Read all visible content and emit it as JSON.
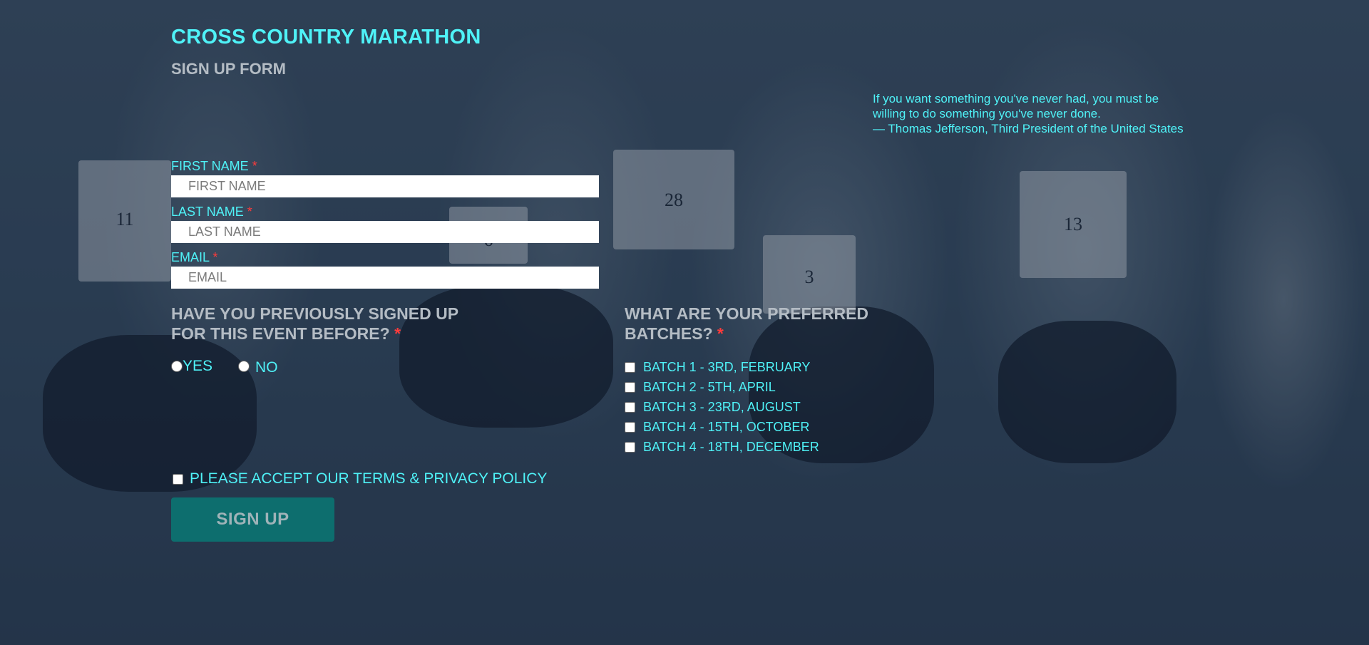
{
  "header": {
    "title": "CROSS COUNTRY MARATHON",
    "subtitle": "SIGN UP FORM"
  },
  "quote": {
    "text": "If you want something you've never had, you must be willing to do something you've never done.",
    "attribution": "— Thomas Jefferson, Third President of the United States"
  },
  "form": {
    "required_marker": "*",
    "first_name": {
      "label": "FIRST NAME",
      "placeholder": "FIRST NAME",
      "value": ""
    },
    "last_name": {
      "label": "LAST NAME",
      "placeholder": "LAST NAME",
      "value": ""
    },
    "email": {
      "label": "EMAIL",
      "placeholder": "EMAIL",
      "value": ""
    },
    "previous_signup": {
      "question_line1": "HAVE YOU PREVIOUSLY SIGNED UP",
      "question_line2": "FOR THIS EVENT BEFORE?",
      "options": [
        {
          "label": "YES",
          "selected": false
        },
        {
          "label": "NO",
          "selected": false
        }
      ]
    },
    "batches": {
      "question_line1": "WHAT ARE YOUR PREFERRED",
      "question_line2": "BATCHES?",
      "options": [
        {
          "label": "BATCH 1 - 3RD, FEBRUARY",
          "checked": false
        },
        {
          "label": "BATCH 2 - 5TH, APRIL",
          "checked": false
        },
        {
          "label": "BATCH 3 - 23RD, AUGUST",
          "checked": false
        },
        {
          "label": "BATCH 4 - 15TH, OCTOBER",
          "checked": false
        },
        {
          "label": "BATCH 4 - 18TH, DECEMBER",
          "checked": false
        }
      ]
    },
    "terms": {
      "label": "PLEASE ACCEPT OUR TERMS & PRIVACY POLICY",
      "checked": false
    },
    "submit_label": "SIGN UP"
  },
  "colors": {
    "accent": "#4ff2f7",
    "muted_heading": "#b4bcc4",
    "required": "#ff3b3b",
    "button_bg": "#0d6e6e",
    "overlay": "#2a3a4e"
  }
}
